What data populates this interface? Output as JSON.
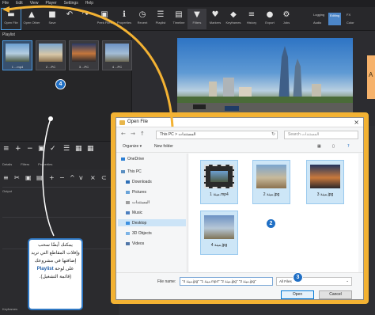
{
  "menu": [
    "File",
    "Edit",
    "View",
    "Player",
    "Settings",
    "Help"
  ],
  "toolbar": {
    "buttons": [
      {
        "icon": "open-folder-icon",
        "label": "Open File"
      },
      {
        "icon": "open-other-icon",
        "label": "Open Other"
      },
      {
        "icon": "save-icon",
        "label": "Save"
      },
      {
        "icon": "undo-icon",
        "label": ""
      },
      {
        "icon": "redo-icon",
        "label": ""
      },
      {
        "icon": "properties-icon",
        "label": "Peek Files"
      },
      {
        "icon": "info-icon",
        "label": "Properties"
      },
      {
        "icon": "recent-icon",
        "label": "Recent"
      },
      {
        "icon": "playlist-icon",
        "label": "Playlist"
      },
      {
        "icon": "timeline-icon",
        "label": "Timeline"
      },
      {
        "icon": "filters-icon",
        "label": "Filters"
      },
      {
        "icon": "markers-icon",
        "label": "Markers"
      },
      {
        "icon": "keyframes-icon",
        "label": "Keyframes"
      },
      {
        "icon": "history-icon",
        "label": "History"
      },
      {
        "icon": "export-icon",
        "label": "Export"
      },
      {
        "icon": "jobs-icon",
        "label": "Jobs"
      }
    ],
    "layout_labels": [
      "Logging",
      "Editing",
      "FX",
      "Audio"
    ],
    "layout_tail": "Color"
  },
  "playlist": {
    "title": "Playlist",
    "clips": [
      "1 ...mp4",
      "2 ...PC",
      "3 ...PC",
      "4 ...PC"
    ],
    "tabs": [
      "Details",
      "Filters",
      "Properties"
    ]
  },
  "timeline": {
    "labels": [
      "Output",
      "Keyframes"
    ]
  },
  "preview_label": "A",
  "dialog": {
    "title": "Open File",
    "path": "This PC  >  المستندات",
    "search_placeholder": "Search المستندات",
    "organize": "Organize ▾",
    "new_folder": "New folder",
    "nav": [
      "OneDrive",
      "This PC",
      "Downloads",
      "Pictures",
      "المستندات",
      "Music",
      "Desktop",
      "3D Objects",
      "Videos"
    ],
    "files": [
      "1 مينة.mp4",
      "2 مينة.jpg",
      "3 مينة.jpg",
      "4 مينة.jpg"
    ],
    "file_name_label": "File name:",
    "file_name_value": "\"4 مينة.jpg\" \"1 مينة.mp4\" \"2 مينة.jpg\" \"3 مينة.jpg\"",
    "file_type": "All Files",
    "open": "Open",
    "cancel": "Cancel"
  },
  "callouts": [
    "2",
    "3",
    "4"
  ],
  "note": {
    "text": "يمكنك أيضًا سحب وإفلات المقاطع التي تريد إضافتها في مشروعك على لوحة",
    "bold": "Playlist",
    "tail": "(قائمة التشغيل)."
  },
  "colors": {
    "accent": "#1f6fc5",
    "highlight_frame": "#f3b233"
  }
}
